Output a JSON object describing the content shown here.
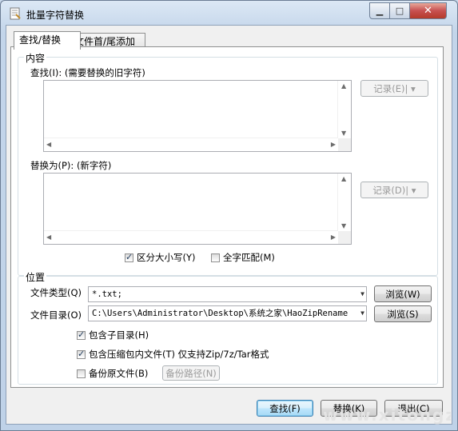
{
  "window": {
    "title": "批量字符替换",
    "controls": {
      "minimize": "▁",
      "maximize": "□",
      "close": "✕"
    }
  },
  "tabs": [
    {
      "label": "查找/替换",
      "active": true
    },
    {
      "label": "文件首/尾添加",
      "active": false
    }
  ],
  "content_group": {
    "label": "内容",
    "find_label": "查找(I): (需要替换的旧字符)",
    "find_value": "",
    "find_history_button": "记录(E)| ▾",
    "replace_label": "替换为(P): (新字符)",
    "replace_value": "",
    "replace_history_button": "记录(D)| ▾",
    "case_sensitive": {
      "label": "区分大小写(Y)",
      "checked": true
    },
    "whole_word": {
      "label": "全字匹配(M)",
      "checked": false
    }
  },
  "location_group": {
    "label": "位置",
    "file_type_label": "文件类型(Q)",
    "file_type_value": "*.txt;",
    "browse_type_button": "浏览(W)",
    "directory_label": "文件目录(O)",
    "directory_value": "C:\\Users\\Administrator\\Desktop\\系统之家\\HaoZipRename",
    "browse_dir_button": "浏览(S)",
    "include_subdirs": {
      "label": "包含子目录(H)",
      "checked": true
    },
    "include_archives": {
      "label": "包含压缩包内文件(T) 仅支持Zip/7z/Tar格式",
      "checked": true
    },
    "backup_original": {
      "label": "备份原文件(B)",
      "checked": false
    },
    "backup_path_button": "备份路径(N)"
  },
  "footer": {
    "find_button": "查找(F)",
    "replace_button": "替换(K)",
    "exit_button": "退出(C)"
  },
  "watermark": "www.xitongzhijia.net"
}
